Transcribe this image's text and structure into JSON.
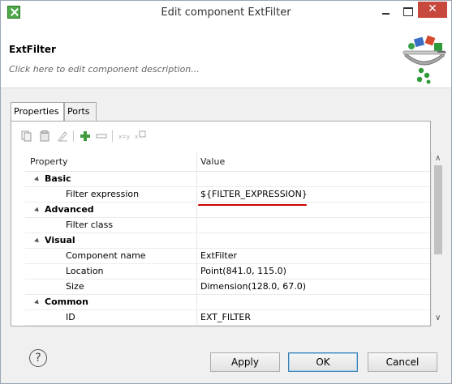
{
  "window": {
    "title": "Edit component ExtFilter",
    "close_glyph": "✕"
  },
  "header": {
    "component_name": "ExtFilter",
    "description_placeholder": "Click here to edit component description..."
  },
  "tabs": [
    {
      "label": "Properties",
      "active": true
    },
    {
      "label": "Ports",
      "active": false
    }
  ],
  "toolbar": {
    "icons": [
      "copy-icon",
      "paste-icon",
      "edit-icon",
      "add-icon",
      "remove-icon",
      "move-up-icon",
      "move-down-icon"
    ]
  },
  "table": {
    "columns": [
      "Property",
      "Value"
    ],
    "rows": [
      {
        "type": "group",
        "name": "Basic",
        "value": ""
      },
      {
        "type": "item",
        "name": "Filter expression",
        "value": "${FILTER_EXPRESSION}"
      },
      {
        "type": "group",
        "name": "Advanced",
        "value": ""
      },
      {
        "type": "item",
        "name": "Filter class",
        "value": ""
      },
      {
        "type": "group",
        "name": "Visual",
        "value": ""
      },
      {
        "type": "item",
        "name": "Component name",
        "value": "ExtFilter"
      },
      {
        "type": "item",
        "name": "Location",
        "value": "Point(841.0, 115.0)"
      },
      {
        "type": "item",
        "name": "Size",
        "value": "Dimension(128.0, 67.0)"
      },
      {
        "type": "group",
        "name": "Common",
        "value": ""
      },
      {
        "type": "item",
        "name": "ID",
        "value": "EXT_FILTER"
      }
    ]
  },
  "footer": {
    "help_glyph": "?",
    "apply_label": "Apply",
    "ok_label": "OK",
    "cancel_label": "Cancel"
  },
  "colors": {
    "highlight_underline": "#cc0000",
    "close_button": "#c7483c"
  }
}
